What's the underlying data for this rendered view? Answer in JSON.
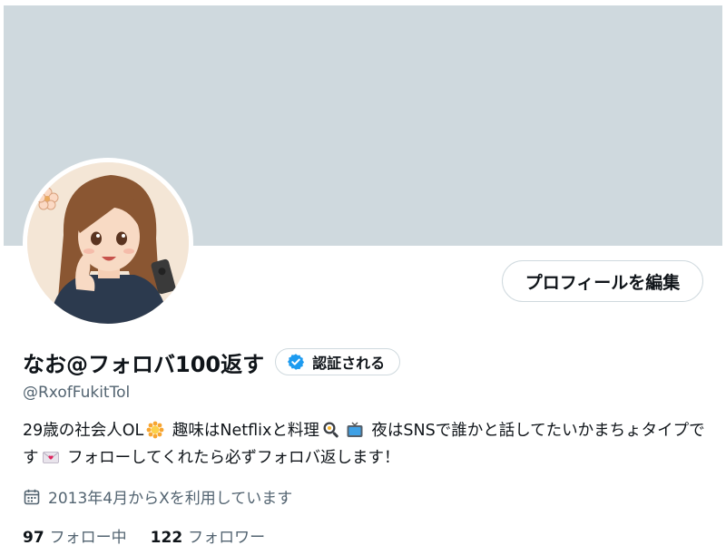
{
  "profile": {
    "display_name": "なお@フォロバ100返す",
    "handle": "@RxofFukitTol",
    "verify_label": "認証される",
    "edit_button_label": "プロフィールを編集",
    "bio": {
      "part1": "29歳の社会人OL",
      "part2": " 趣味はNetflixと料理",
      "part3": " 夜はSNSで誰かと話してたいかまちょタイプです",
      "part4": " フォローしてくれたら必ずフォロバ返します！"
    },
    "joined_text": "2013年4月からXを利用しています",
    "stats": {
      "following_count": "97",
      "following_label": "フォロー中",
      "followers_count": "122",
      "followers_label": "フォロワー"
    }
  },
  "colors": {
    "banner": "#cfd9de",
    "verified_blue": "#1d9bf0",
    "secondary_text": "#536471",
    "border": "#cfd9de"
  },
  "icons": {
    "verified": "verified-badge-icon",
    "calendar": "calendar-icon",
    "emoji_sun": "sun-emoji-icon",
    "emoji_pan": "frying-pan-emoji-icon",
    "emoji_tv": "television-emoji-icon",
    "emoji_letter": "love-letter-emoji-icon"
  }
}
